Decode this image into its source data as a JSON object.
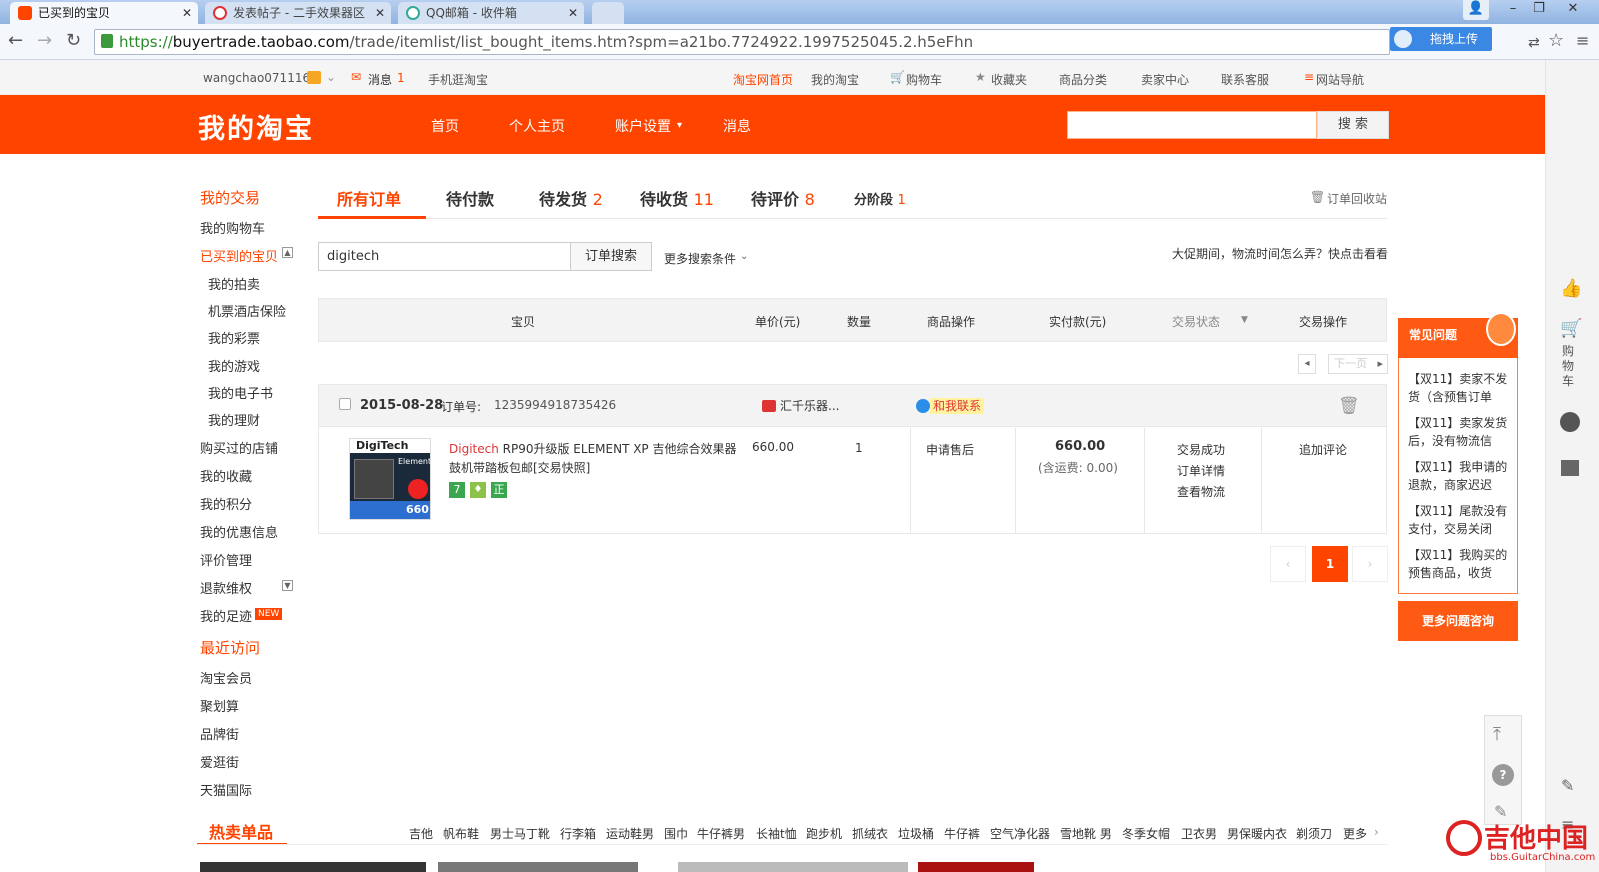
{
  "browser": {
    "tabs": [
      {
        "label": "已买到的宝贝",
        "color": "#f40"
      },
      {
        "label": "发表帖子 - 二手效果器区",
        "color": "#d33"
      },
      {
        "label": "QQ邮箱 - 收件箱",
        "color": "#3a9"
      }
    ],
    "url_scheme": "https://",
    "url_host": "buyertrade.taobao.com",
    "url_path": "/trade/itemlist/list_bought_items.htm?spm=a21bo.7724922.1997525045.2.h5eFhn",
    "upload_label": "拖拽上传"
  },
  "site_nav": {
    "username": "wangchao071116",
    "messages_label": "消息",
    "messages_count": "1",
    "mobile": "手机逛淘宝",
    "links": [
      "淘宝网首页",
      "我的淘宝",
      "购物车",
      "收藏夹",
      "商品分类",
      "卖家中心",
      "联系客服",
      "网站导航"
    ]
  },
  "header": {
    "logo": "我的淘宝",
    "nav": [
      "首页",
      "个人主页",
      "账户设置",
      "消息"
    ],
    "search_button": "搜 索"
  },
  "left_menu": {
    "section1": "我的交易",
    "items1": [
      "我的购物车",
      "已买到的宝贝"
    ],
    "sub_items": [
      "我的拍卖",
      "机票酒店保险",
      "我的彩票",
      "我的游戏",
      "我的电子书",
      "我的理财"
    ],
    "items2": [
      "购买过的店铺",
      "我的收藏",
      "我的积分",
      "我的优惠信息",
      "评价管理",
      "退款维权",
      "我的足迹"
    ],
    "new_badge": "NEW",
    "section2": "最近访问",
    "recent": [
      "淘宝会员",
      "聚划算",
      "品牌街",
      "爱逛街",
      "天猫国际"
    ]
  },
  "order_tabs": [
    {
      "label": "所有订单",
      "count": ""
    },
    {
      "label": "待付款",
      "count": ""
    },
    {
      "label": "待发货",
      "count": "2"
    },
    {
      "label": "待收货",
      "count": "11"
    },
    {
      "label": "待评价",
      "count": "8"
    },
    {
      "label": "分阶段",
      "count": "1"
    }
  ],
  "recycle_label": "订单回收站",
  "search": {
    "value": "digitech",
    "button": "订单搜索",
    "more": "更多搜索条件",
    "promo_tip": "大促期间，物流时间怎么弄？快点击看看"
  },
  "table_headers": [
    "宝贝",
    "单价(元)",
    "数量",
    "商品操作",
    "实付款(元)",
    "交易状态",
    "交易操作"
  ],
  "pager_top_next": "下一页",
  "order": {
    "date": "2015-08-28",
    "order_no_label": "订单号:",
    "order_no": "1235994918735426",
    "shop": "汇千乐器...",
    "contact": "和我联系",
    "item_brand": "Digitech",
    "item_title_1": " RP90升级版 ELEMENT XP 吉他综合效果器",
    "item_title_2": "鼓机带踏板包邮[交易快照]",
    "badges": [
      "7",
      "♦",
      "正"
    ],
    "price": "660.00",
    "qty": "1",
    "item_action": "申请售后",
    "paid": "660.00",
    "shipping": "(含运费: 0.00)",
    "status": [
      "交易成功",
      "订单详情",
      "查看物流"
    ],
    "action": "追加评论",
    "thumb_brand": "DigiTech",
    "thumb_model": "Element XP",
    "thumb_price": "660"
  },
  "pagination": {
    "prev": "‹",
    "current": "1",
    "next": "›"
  },
  "faq": {
    "title": "常见问题",
    "items": [
      "【双11】卖家不发货（含预售订单",
      "【双11】卖家发货后，没有物流信",
      "【双11】我申请的退款，商家迟迟",
      "【双11】尾款没有支付，交易关闭",
      "【双11】我购买的预售商品，收货"
    ],
    "more": "更多问题咨询"
  },
  "side_tools": {
    "cart": "购物车"
  },
  "hot": {
    "title": "热卖单品",
    "items": [
      "吉他",
      "帆布鞋",
      "男士马丁靴",
      "行李箱",
      "运动鞋男",
      "围巾",
      "牛仔裤男",
      "长袖t恤",
      "跑步机",
      "抓绒衣",
      "垃圾桶",
      "牛仔裤",
      "空气净化器",
      "雪地靴 男",
      "冬季女帽",
      "卫衣男",
      "男保暖内衣",
      "剃须刀"
    ],
    "more": "更多"
  },
  "watermark": {
    "cn": "吉他中国",
    "en": "bbs.GuitarChina.com"
  }
}
